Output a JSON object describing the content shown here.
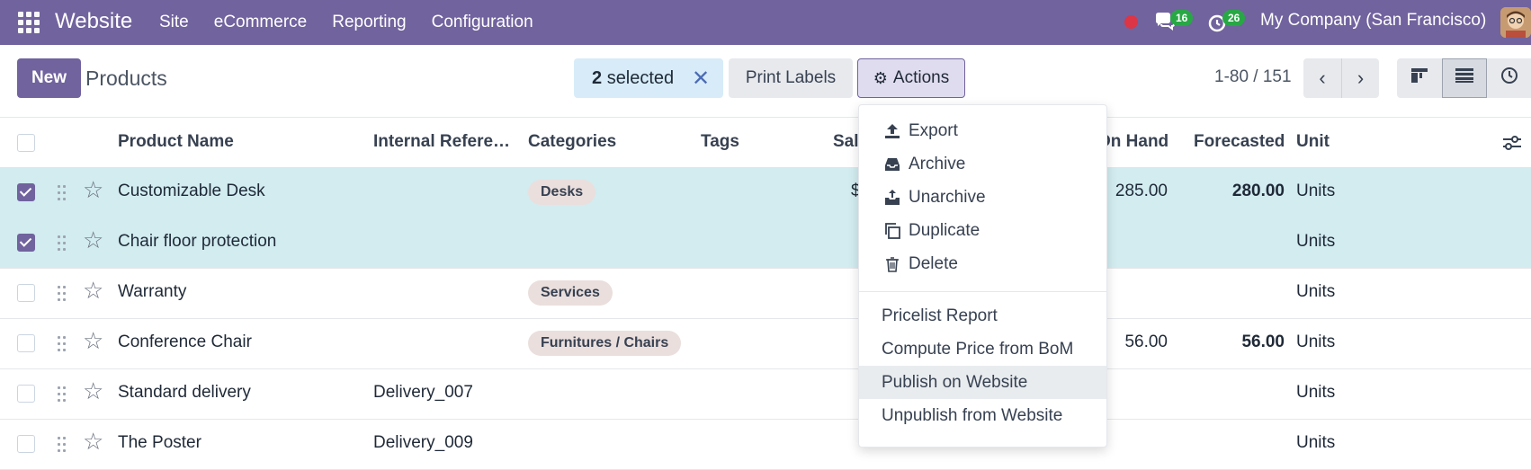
{
  "navbar": {
    "brand": "Website",
    "menu": [
      "Site",
      "eCommerce",
      "Reporting",
      "Configuration"
    ],
    "chat_count": "16",
    "activity_count": "26",
    "company": "My Company (San Francisco)"
  },
  "control": {
    "new_label": "New",
    "title": "Products",
    "selected_number": "2",
    "selected_word": "selected",
    "clear": "✕",
    "print_labels": "Print Labels",
    "actions": "Actions",
    "pager": "1-80 / 151",
    "prev": "‹",
    "next": "›"
  },
  "table": {
    "headers": {
      "name": "Product Name",
      "ref": "Internal Refere…",
      "categories": "Categories",
      "tags": "Tags",
      "sales": "Sal",
      "on_hand": "On Hand",
      "forecasted": "Forecasted",
      "unit": "Unit"
    },
    "rows": [
      {
        "selected": true,
        "name": "Customizable Desk",
        "ref": "",
        "category": "Desks",
        "sales": "$",
        "on_hand": "285.00",
        "forecasted": "280.00",
        "unit": "Units"
      },
      {
        "selected": true,
        "name": "Chair floor protection",
        "ref": "",
        "category": "",
        "sales": "",
        "on_hand": "",
        "forecasted": "",
        "unit": "Units"
      },
      {
        "selected": false,
        "name": "Warranty",
        "ref": "",
        "category": "Services",
        "sales": "",
        "on_hand": "",
        "forecasted": "",
        "unit": "Units"
      },
      {
        "selected": false,
        "name": "Conference Chair",
        "ref": "",
        "category": "Furnitures / Chairs",
        "sales": "",
        "on_hand": "56.00",
        "forecasted": "56.00",
        "unit": "Units"
      },
      {
        "selected": false,
        "name": "Standard delivery",
        "ref": "Delivery_007",
        "category": "",
        "sales": "",
        "on_hand": "",
        "forecasted": "",
        "unit": "Units"
      },
      {
        "selected": false,
        "name": "The Poster",
        "ref": "Delivery_009",
        "category": "",
        "sales": "",
        "on_hand": "",
        "forecasted": "",
        "unit": "Units"
      }
    ]
  },
  "actions_menu": {
    "items": [
      {
        "label": "Export",
        "icon": "upload-icon"
      },
      {
        "label": "Archive",
        "icon": "inbox-icon"
      },
      {
        "label": "Unarchive",
        "icon": "unarchive-icon"
      },
      {
        "label": "Duplicate",
        "icon": "copy-icon"
      },
      {
        "label": "Delete",
        "icon": "trash-icon"
      }
    ],
    "extra": [
      "Pricelist Report",
      "Compute Price from BoM",
      "Publish on Website",
      "Unpublish from Website"
    ]
  },
  "colors": {
    "brand": "#71639e",
    "selected_row": "#d2ecf0",
    "badge": "#28a745"
  }
}
